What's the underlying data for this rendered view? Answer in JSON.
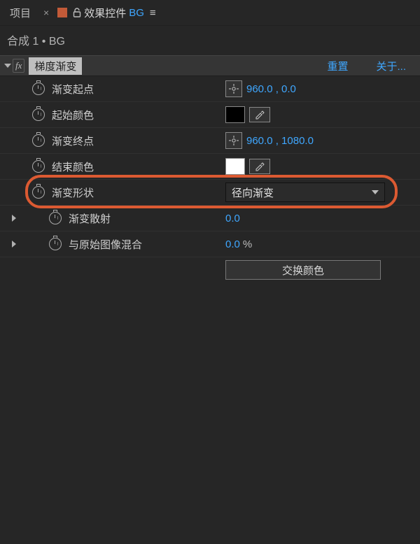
{
  "tabs": {
    "project": "项目",
    "close_glyph": "×",
    "panel_title": "效果控件",
    "layer_name": "BG",
    "burger_glyph": "≡"
  },
  "breadcrumb": "合成 1 • BG",
  "effect": {
    "name": "梯度渐变",
    "reset": "重置",
    "about": "关于..."
  },
  "params": {
    "start_point": {
      "label": "渐变起点",
      "value": "960.0 , 0.0"
    },
    "start_color": {
      "label": "起始颜色"
    },
    "end_point": {
      "label": "渐变终点",
      "value": "960.0 , 1080.0"
    },
    "end_color": {
      "label": "结束颜色"
    },
    "shape": {
      "label": "渐变形状",
      "value": "径向渐变"
    },
    "scatter": {
      "label": "渐变散射",
      "value": "0.0"
    },
    "blend": {
      "label": "与原始图像混合",
      "value": "0.0",
      "unit": "%"
    }
  },
  "swap_button": "交换颜色"
}
